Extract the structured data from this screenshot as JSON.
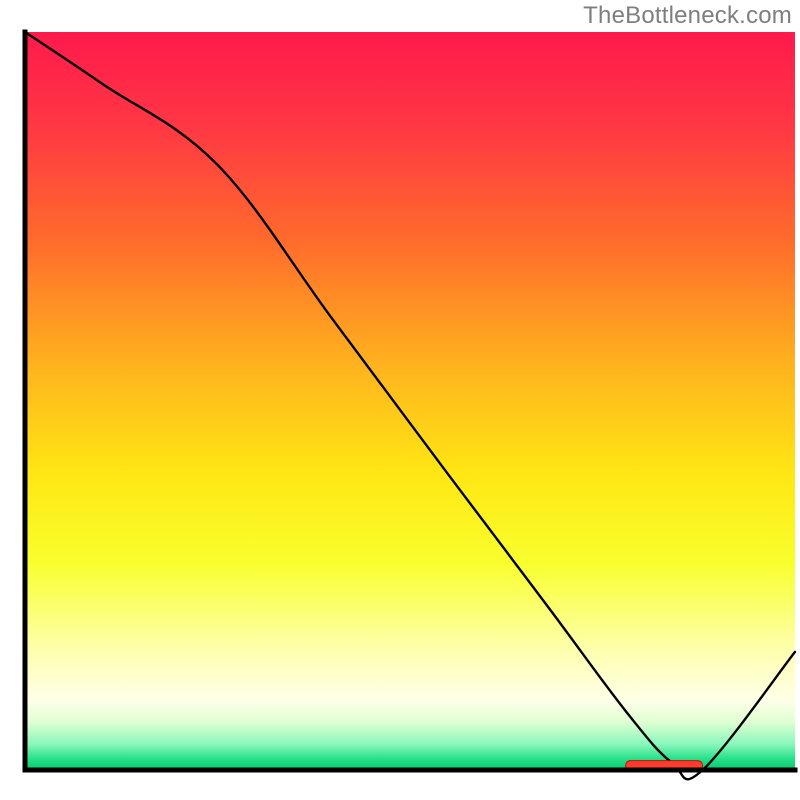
{
  "watermark": "TheBottleneck.com",
  "colors": {
    "axis": "#000000",
    "line": "#000000",
    "highlight_fill": "#ff3a2e",
    "highlight_stroke": "#b31409",
    "gradient_stops": [
      {
        "offset": 0.0,
        "color": "#ff1a4c"
      },
      {
        "offset": 0.12,
        "color": "#ff3545"
      },
      {
        "offset": 0.28,
        "color": "#ff6a2c"
      },
      {
        "offset": 0.45,
        "color": "#ffb21e"
      },
      {
        "offset": 0.6,
        "color": "#ffe714"
      },
      {
        "offset": 0.72,
        "color": "#f8ff2d"
      },
      {
        "offset": 0.83,
        "color": "#fdffa6"
      },
      {
        "offset": 0.905,
        "color": "#ffffe8"
      },
      {
        "offset": 0.935,
        "color": "#dfffd3"
      },
      {
        "offset": 0.965,
        "color": "#89f7bb"
      },
      {
        "offset": 0.985,
        "color": "#27e088"
      },
      {
        "offset": 1.0,
        "color": "#06c96e"
      }
    ]
  },
  "chart_data": {
    "type": "line",
    "title": "",
    "xlabel": "",
    "ylabel": "",
    "xlim": [
      0,
      100
    ],
    "ylim": [
      0,
      100
    ],
    "x": [
      0,
      10,
      25,
      40,
      55,
      68,
      78,
      84,
      88,
      100
    ],
    "values": [
      100,
      93,
      82,
      61,
      40,
      22,
      8,
      1,
      0,
      16
    ],
    "highlight_x_range": [
      78,
      88
    ],
    "highlight_y": 0.6
  }
}
